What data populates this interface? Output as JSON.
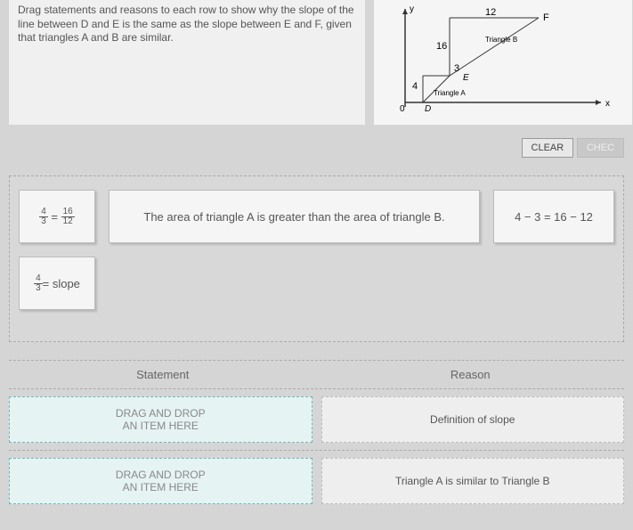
{
  "instruction": "Drag statements and reasons to each row to show why the slope of the line between D and E is the same as the slope between E and F, given that triangles A and B are similar.",
  "diagram": {
    "y_label": "y",
    "x_label": "x",
    "top_num": "12",
    "side_num": "16",
    "mid_num": "3",
    "left_num": "4",
    "point_F": "F",
    "point_E": "E",
    "point_D": "D",
    "origin": "0",
    "tri_a": "Triangle A",
    "tri_b": "Triangle B"
  },
  "buttons": {
    "clear": "CLEAR",
    "check": "CHEC"
  },
  "tiles": {
    "frac1_n": "4",
    "frac1_d": "3",
    "frac2_n": "16",
    "frac2_d": "12",
    "middle": "The area of triangle A is greater than the area of triangle B.",
    "eq": "4 − 3 = 16 − 12",
    "slope_n": "4",
    "slope_d": "3",
    "slope_txt": " = slope"
  },
  "table": {
    "stmt_header": "Statement",
    "reason_header": "Reason",
    "drop_text": "DRAG AND DROP\nAN ITEM HERE",
    "reason1": "Definition of slope",
    "reason2": "Triangle A is similar to Triangle B"
  }
}
